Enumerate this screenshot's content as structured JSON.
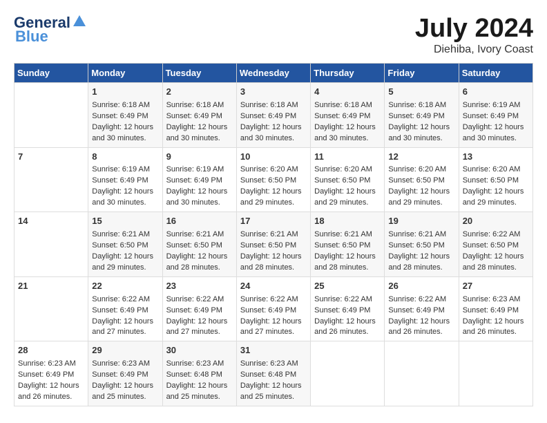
{
  "header": {
    "logo_line1": "General",
    "logo_line2": "Blue",
    "month_year": "July 2024",
    "location": "Diehiba, Ivory Coast"
  },
  "days_of_week": [
    "Sunday",
    "Monday",
    "Tuesday",
    "Wednesday",
    "Thursday",
    "Friday",
    "Saturday"
  ],
  "weeks": [
    [
      {
        "day": "",
        "info": ""
      },
      {
        "day": "1",
        "info": "Sunrise: 6:18 AM\nSunset: 6:49 PM\nDaylight: 12 hours\nand 30 minutes."
      },
      {
        "day": "2",
        "info": "Sunrise: 6:18 AM\nSunset: 6:49 PM\nDaylight: 12 hours\nand 30 minutes."
      },
      {
        "day": "3",
        "info": "Sunrise: 6:18 AM\nSunset: 6:49 PM\nDaylight: 12 hours\nand 30 minutes."
      },
      {
        "day": "4",
        "info": "Sunrise: 6:18 AM\nSunset: 6:49 PM\nDaylight: 12 hours\nand 30 minutes."
      },
      {
        "day": "5",
        "info": "Sunrise: 6:18 AM\nSunset: 6:49 PM\nDaylight: 12 hours\nand 30 minutes."
      },
      {
        "day": "6",
        "info": "Sunrise: 6:19 AM\nSunset: 6:49 PM\nDaylight: 12 hours\nand 30 minutes."
      }
    ],
    [
      {
        "day": "7",
        "info": ""
      },
      {
        "day": "8",
        "info": "Sunrise: 6:19 AM\nSunset: 6:49 PM\nDaylight: 12 hours\nand 30 minutes."
      },
      {
        "day": "9",
        "info": "Sunrise: 6:19 AM\nSunset: 6:49 PM\nDaylight: 12 hours\nand 30 minutes."
      },
      {
        "day": "10",
        "info": "Sunrise: 6:20 AM\nSunset: 6:50 PM\nDaylight: 12 hours\nand 29 minutes."
      },
      {
        "day": "11",
        "info": "Sunrise: 6:20 AM\nSunset: 6:50 PM\nDaylight: 12 hours\nand 29 minutes."
      },
      {
        "day": "12",
        "info": "Sunrise: 6:20 AM\nSunset: 6:50 PM\nDaylight: 12 hours\nand 29 minutes."
      },
      {
        "day": "13",
        "info": "Sunrise: 6:20 AM\nSunset: 6:50 PM\nDaylight: 12 hours\nand 29 minutes."
      }
    ],
    [
      {
        "day": "14",
        "info": ""
      },
      {
        "day": "15",
        "info": "Sunrise: 6:21 AM\nSunset: 6:50 PM\nDaylight: 12 hours\nand 29 minutes."
      },
      {
        "day": "16",
        "info": "Sunrise: 6:21 AM\nSunset: 6:50 PM\nDaylight: 12 hours\nand 28 minutes."
      },
      {
        "day": "17",
        "info": "Sunrise: 6:21 AM\nSunset: 6:50 PM\nDaylight: 12 hours\nand 28 minutes."
      },
      {
        "day": "18",
        "info": "Sunrise: 6:21 AM\nSunset: 6:50 PM\nDaylight: 12 hours\nand 28 minutes."
      },
      {
        "day": "19",
        "info": "Sunrise: 6:21 AM\nSunset: 6:50 PM\nDaylight: 12 hours\nand 28 minutes."
      },
      {
        "day": "20",
        "info": "Sunrise: 6:22 AM\nSunset: 6:50 PM\nDaylight: 12 hours\nand 28 minutes."
      }
    ],
    [
      {
        "day": "21",
        "info": ""
      },
      {
        "day": "22",
        "info": "Sunrise: 6:22 AM\nSunset: 6:49 PM\nDaylight: 12 hours\nand 27 minutes."
      },
      {
        "day": "23",
        "info": "Sunrise: 6:22 AM\nSunset: 6:49 PM\nDaylight: 12 hours\nand 27 minutes."
      },
      {
        "day": "24",
        "info": "Sunrise: 6:22 AM\nSunset: 6:49 PM\nDaylight: 12 hours\nand 27 minutes."
      },
      {
        "day": "25",
        "info": "Sunrise: 6:22 AM\nSunset: 6:49 PM\nDaylight: 12 hours\nand 26 minutes."
      },
      {
        "day": "26",
        "info": "Sunrise: 6:22 AM\nSunset: 6:49 PM\nDaylight: 12 hours\nand 26 minutes."
      },
      {
        "day": "27",
        "info": "Sunrise: 6:23 AM\nSunset: 6:49 PM\nDaylight: 12 hours\nand 26 minutes."
      }
    ],
    [
      {
        "day": "28",
        "info": "Sunrise: 6:23 AM\nSunset: 6:49 PM\nDaylight: 12 hours\nand 26 minutes."
      },
      {
        "day": "29",
        "info": "Sunrise: 6:23 AM\nSunset: 6:49 PM\nDaylight: 12 hours\nand 25 minutes."
      },
      {
        "day": "30",
        "info": "Sunrise: 6:23 AM\nSunset: 6:48 PM\nDaylight: 12 hours\nand 25 minutes."
      },
      {
        "day": "31",
        "info": "Sunrise: 6:23 AM\nSunset: 6:48 PM\nDaylight: 12 hours\nand 25 minutes."
      },
      {
        "day": "",
        "info": ""
      },
      {
        "day": "",
        "info": ""
      },
      {
        "day": "",
        "info": ""
      }
    ]
  ]
}
